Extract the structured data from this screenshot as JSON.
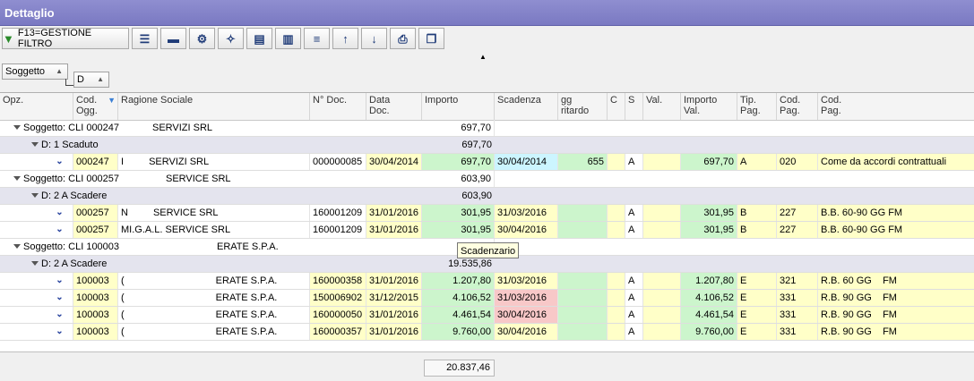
{
  "title": "Dettaglio",
  "toolbar": {
    "filter_label": "F13=GESTIONE FILTRO",
    "buttons": [
      "filter-icon",
      "group-icon",
      "collapse-icon",
      "gear-icon",
      "magic-wand-icon",
      "layers-icon",
      "tree-icon",
      "menu-icon",
      "arrow-up-icon",
      "arrow-down-icon",
      "print-icon",
      "copy-icon"
    ]
  },
  "grouping": {
    "level1": "Soggetto",
    "level2": "D"
  },
  "columns": [
    "Opz.",
    "Cod.\nOgg.",
    "Ragione Sociale",
    "N° Doc.",
    "Data\nDoc.",
    "Importo",
    "Scadenza",
    "gg\nritardo",
    "C",
    "S",
    "Val.",
    "Importo\nVal.",
    "Tip.\nPag.",
    "Cod.\nPag.",
    "Cod.\nPag."
  ],
  "groups": [
    {
      "label": "Soggetto: CLI 000247",
      "name_suffix": "SERVIZI SRL",
      "total": "697,70",
      "sub": {
        "label": "D: 1 Scaduto",
        "total": "697,70"
      },
      "rows": [
        {
          "cod": "000247",
          "ragione": "SERVIZI SRL",
          "prefix": "I",
          "ndoc": "000000085",
          "data": "30/04/2014",
          "importo": "697,70",
          "scadenza": "30/04/2014",
          "gg": "655",
          "c": "",
          "s": "A",
          "val": "",
          "importo_val": "697,70",
          "tip": "A",
          "codpag": "020",
          "desc": "Come da accordi contrattuali"
        }
      ]
    },
    {
      "label": "Soggetto: CLI 000257",
      "name_suffix": "SERVICE SRL",
      "total": "603,90",
      "sub": {
        "label": "D: 2 A Scadere",
        "total": "603,90"
      },
      "rows": [
        {
          "cod": "000257",
          "ragione": "SERVICE SRL",
          "prefix": "N",
          "ndoc": "160001209",
          "data": "31/01/2016",
          "importo": "301,95",
          "scadenza": "31/03/2016",
          "gg": "",
          "c": "",
          "s": "A",
          "val": "",
          "importo_val": "301,95",
          "tip": "B",
          "codpag": "227",
          "desc": "B.B. 60-90 GG FM"
        },
        {
          "cod": "000257",
          "ragione": "SERVICE SRL",
          "prefix": "MI.G.A.L.",
          "ndoc": "160001209",
          "data": "31/01/2016",
          "importo": "301,95",
          "scadenza": "30/04/2016",
          "gg": "",
          "c": "",
          "s": "A",
          "val": "",
          "importo_val": "301,95",
          "tip": "B",
          "codpag": "227",
          "desc": "B.B. 60-90 GG FM"
        }
      ]
    },
    {
      "label": "Soggetto: CLI 100003",
      "name_suffix": "ERATE S.P.A.",
      "total": "19",
      "sub": {
        "label": "D: 2 A Scadere",
        "total": "19.535,86"
      },
      "rows": [
        {
          "cod": "100003",
          "ragione": "ERATE S.P.A.",
          "prefix": "(",
          "ndoc": "160000358",
          "data": "31/01/2016",
          "importo": "1.207,80",
          "scadenza": "31/03/2016",
          "gg": "",
          "c": "",
          "s": "A",
          "val": "",
          "importo_val": "1.207,80",
          "tip": "E",
          "codpag": "321",
          "desc": "R.B. 60 GG    FM"
        },
        {
          "cod": "100003",
          "ragione": "ERATE S.P.A.",
          "prefix": "(",
          "ndoc": "150006902",
          "data": "31/12/2015",
          "importo": "4.106,52",
          "scadenza": "31/03/2016",
          "gg": "",
          "c": "",
          "s": "A",
          "val": "",
          "importo_val": "4.106,52",
          "tip": "E",
          "codpag": "331",
          "desc": "R.B. 90 GG    FM"
        },
        {
          "cod": "100003",
          "ragione": "ERATE S.P.A.",
          "prefix": "(",
          "ndoc": "160000050",
          "data": "31/01/2016",
          "importo": "4.461,54",
          "scadenza": "30/04/2016",
          "gg": "",
          "c": "",
          "s": "A",
          "val": "",
          "importo_val": "4.461,54",
          "tip": "E",
          "codpag": "331",
          "desc": "R.B. 90 GG    FM"
        },
        {
          "cod": "100003",
          "ragione": "ERATE S.P.A.",
          "prefix": "(",
          "ndoc": "160000357",
          "data": "31/01/2016",
          "importo": "9.760,00",
          "scadenza": "30/04/2016",
          "gg": "",
          "c": "",
          "s": "A",
          "val": "",
          "importo_val": "9.760,00",
          "tip": "E",
          "codpag": "331",
          "desc": "R.B. 90 GG    FM"
        }
      ]
    }
  ],
  "tooltip": "Scadenzario",
  "footer": {
    "total": "20.837,46"
  }
}
